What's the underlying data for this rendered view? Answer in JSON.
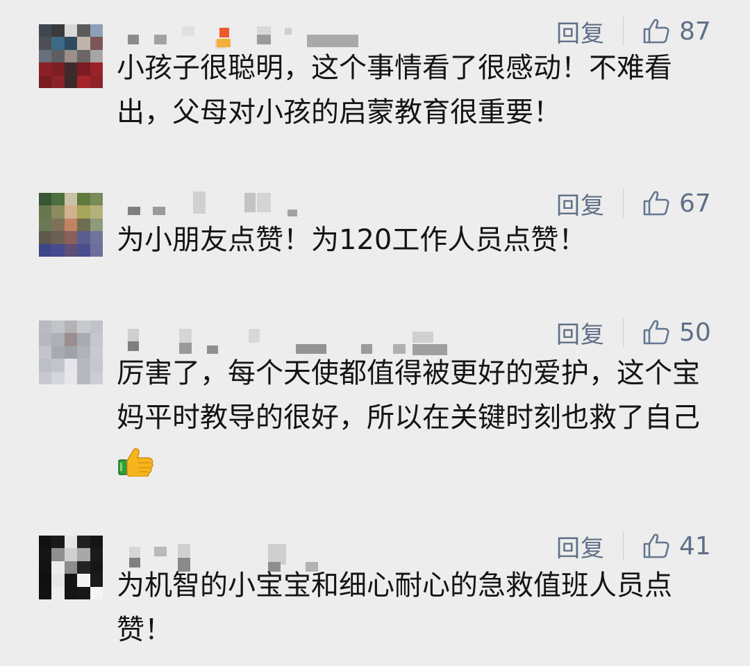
{
  "reply_label": "回复",
  "comments": [
    {
      "likes": "87",
      "text": "小孩子很聪明，这个事情看了很感动！不难看出，父母对小孩的启蒙教育很重要！",
      "avatar_colors": [
        "#3e4750",
        "#3a3a3a",
        "#d8d8d8",
        "#5b5b5b",
        "#8ea0b8",
        "#4d4f54",
        "#3c6a86",
        "#2f4b5f",
        "#bfb5ad",
        "#7c5658",
        "#68707b",
        "#5e5e62",
        "#9a8f89",
        "#6b6769",
        "#a8a6a5",
        "#8d2026",
        "#7d1e24",
        "#3d2b2d",
        "#7a1c21",
        "#9a2329",
        "#7a1c20",
        "#8b2428",
        "#3a2a2c",
        "#a2262a",
        "#8e2226"
      ]
    },
    {
      "likes": "67",
      "text": "为小朋友点赞！为120工作人员点赞！",
      "avatar_colors": [
        "#3a5531",
        "#4d6e3f",
        "#c9c2a6",
        "#5e7a3f",
        "#7a8b5a",
        "#67774e",
        "#8a8b5f",
        "#d2b18f",
        "#a8a65a",
        "#b2b27a",
        "#6a7a55",
        "#7d7258",
        "#c18463",
        "#6d6e51",
        "#8d9b7c",
        "#5e5a4b",
        "#6c5f56",
        "#8b5f59",
        "#5a5d8e",
        "#70739b",
        "#3d4589",
        "#454a8e",
        "#5e4e76",
        "#494e90",
        "#6c6f9c"
      ]
    },
    {
      "likes": "50",
      "text": "厉害了，每个天使都值得被更好的爱护，这个宝妈平时教导的很好，所以在关键时刻也救了自己",
      "has_thumb_emoji": true,
      "avatar_colors": [
        "#b8bac0",
        "#c2c4ca",
        "#b4b2b4",
        "#c7c9cf",
        "#c0c2c8",
        "#b7b8bf",
        "#aeb0b6",
        "#9b8e8f",
        "#a9abb2",
        "#c5c7cd",
        "#c3c5cb",
        "#a7aab1",
        "#9fa2a9",
        "#b1b3ba",
        "#c8cad0",
        "#bdbfc6",
        "#c3c5cc",
        "#e4e4ea",
        "#b7b9c0",
        "#c5c7cc",
        "#c7c9ce",
        "#d4d6db",
        "#e6e6eb",
        "#b6b8bf",
        "#cbcdd2"
      ]
    },
    {
      "likes": "41",
      "text": "为机智的小宝宝和细心耐心的急救值班人员点赞！",
      "avatar_colors": [
        "#111111",
        "#1a1a1a",
        "#e5e5e5",
        "#202020",
        "#151515",
        "#151515",
        "#8f8f8f",
        "#d0d0d0",
        "#a8a8a8",
        "#1b1b1b",
        "#121212",
        "#ececec",
        "#8d8d8d",
        "#222222",
        "#161616",
        "#101010",
        "#e6e6e6",
        "#151515",
        "#f3f3f3",
        "#1a1a1a",
        "#111111",
        "#ededed",
        "#141414",
        "#171717",
        "#f5f5f5"
      ]
    }
  ]
}
